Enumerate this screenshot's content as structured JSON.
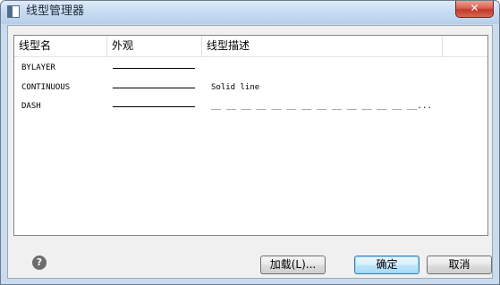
{
  "window": {
    "title": "线型管理器",
    "close_label": "✕"
  },
  "list": {
    "headers": {
      "name": "线型名",
      "appearance": "外观",
      "description": "线型描述"
    },
    "rows": [
      {
        "name": "BYLAYER",
        "appearance": "solid",
        "description": ""
      },
      {
        "name": "CONTINUOUS",
        "appearance": "solid",
        "description": "Solid line"
      },
      {
        "name": "DASH",
        "appearance": "solid",
        "description": "__ __ __ __ __ __ __ __ __ __ __ __ __ __..."
      }
    ]
  },
  "footer": {
    "help_icon": "question-mark-icon",
    "help_label": "?",
    "load_label": "加载(L)...",
    "ok_label": "确定",
    "cancel_label": "取消"
  }
}
